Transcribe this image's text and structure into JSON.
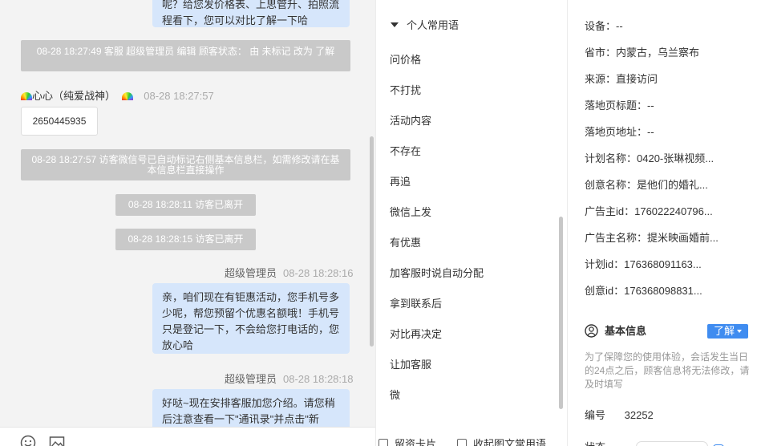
{
  "chat": {
    "msg_top_text": "呢？给您发价格表、上思管升、拍照流程看下，您可以对比了解一下哈",
    "sys1": "08-28 18:27:49 客服 超级管理员 编辑 顾客状态： 由 未标记 改为 了解",
    "visitor_name": "心心（纯爱战神）",
    "visitor_time": "08-28 18:27:57",
    "phone": "2650445935",
    "sys2": "08-28 18:27:57 访客微信号已自动标记右侧基本信息栏，如需修改请在基本信息栏直接操作",
    "sys3": "08-28 18:28:11 访客已离开",
    "sys4": "08-28 18:28:15 访客已离开",
    "agent1_name": "超级管理员",
    "agent1_time": "08-28 18:28:16",
    "agent1_text": "亲，咱们现在有钜惠活动，您手机号多少呢，帮您预留个优惠名额哦！手机号只是登记一下，不会给您打电话的，您放心哈",
    "agent2_name": "超级管理员",
    "agent2_time": "08-28 18:28:18",
    "agent2_text": "好哒~现在安排客服加您介绍。请您稍后注意查看一下\"通讯录\"并点击\"新"
  },
  "phrases": {
    "header": "个人常用语",
    "items": [
      "问价格",
      "不打扰",
      "活动内容",
      "不存在",
      "再追",
      "微信上发",
      "有优惠",
      "加客服时说自动分配",
      "拿到联系后",
      "对比再决定",
      "让加客服",
      "微"
    ],
    "footer_left": "留资卡片",
    "footer_right": "收起图文常用语"
  },
  "info": {
    "rows": [
      "设备：--",
      "省市：内蒙古，乌兰察布",
      "来源：直接访问",
      "落地页标题：--",
      "落地页地址：--",
      "计划名称：0420-张琳视频...",
      "创意名称：是他们的婚礼...",
      "广告主id：176022240796...",
      "广告主名称：提米映画婚前...",
      "计划id：176368091163...",
      "创意id：176368098831..."
    ],
    "section_title": "基本信息",
    "learn_label": "了解",
    "notice": "为了保障您的使用体验，会话发生当日的24点之后，顾客信息将无法修改，请及时填写",
    "serial_label": "编号",
    "serial_value": "32252",
    "cut_label": "状态"
  },
  "icons": {
    "emoji": "smile-icon",
    "image": "image-icon",
    "person": "person-circle-icon"
  },
  "colors": {
    "agent_bubble": "#d6e6fb",
    "system_msg": "#c9c9c9",
    "accent": "#3f8cf0"
  }
}
